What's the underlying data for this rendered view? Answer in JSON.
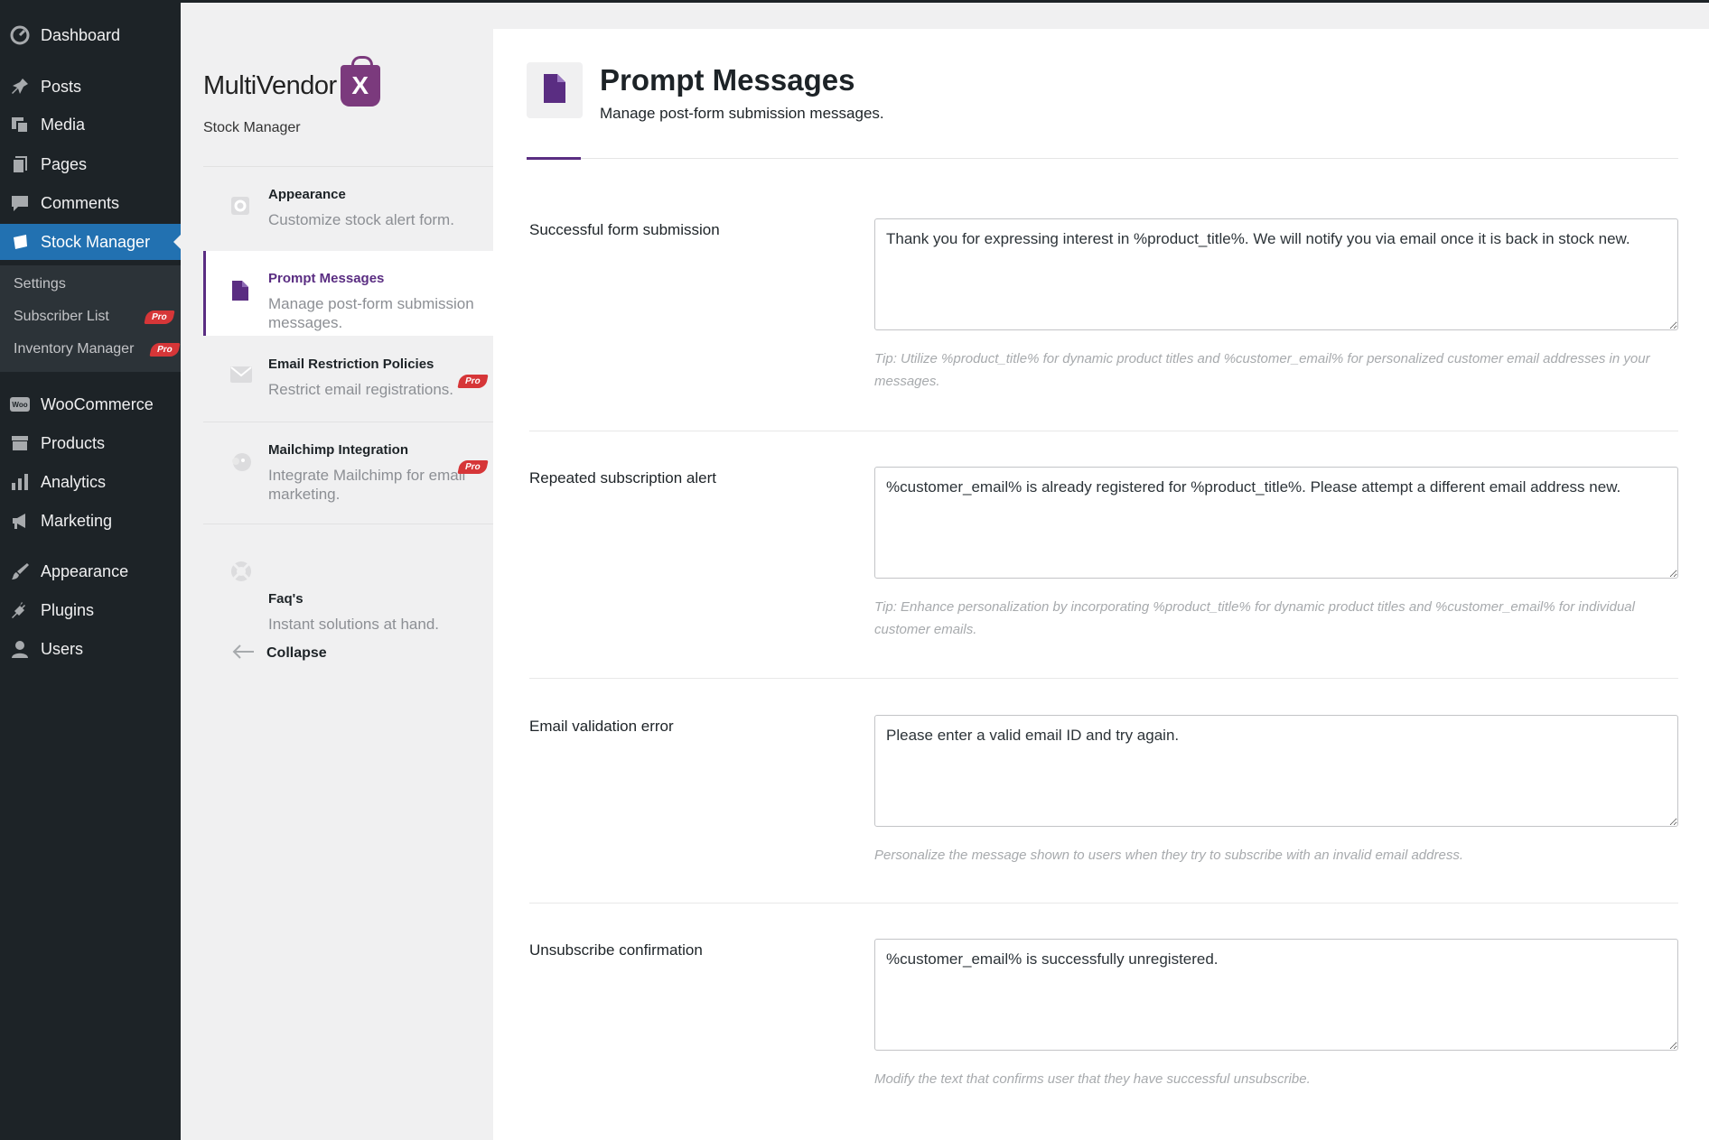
{
  "wp_menu": {
    "items": [
      {
        "label": "Dashboard",
        "icon": "dashboard-icon"
      },
      {
        "label": "Posts",
        "icon": "pin-icon"
      },
      {
        "label": "Media",
        "icon": "media-icon"
      },
      {
        "label": "Pages",
        "icon": "pages-icon"
      },
      {
        "label": "Comments",
        "icon": "comment-icon"
      },
      {
        "label": "Stock Manager",
        "icon": "stock-manager-icon"
      },
      {
        "label": "WooCommerce",
        "icon": "woocommerce-icon"
      },
      {
        "label": "Products",
        "icon": "archive-icon"
      },
      {
        "label": "Analytics",
        "icon": "bar-chart-icon"
      },
      {
        "label": "Marketing",
        "icon": "megaphone-icon"
      },
      {
        "label": "Appearance",
        "icon": "brush-icon"
      },
      {
        "label": "Plugins",
        "icon": "plugin-icon"
      },
      {
        "label": "Users",
        "icon": "user-icon"
      }
    ],
    "sub": [
      {
        "label": "Settings"
      },
      {
        "label": "Subscriber List",
        "badge": "Pro"
      },
      {
        "label": "Inventory Manager",
        "badge": "Pro"
      }
    ],
    "woo_icon_text": "Woo"
  },
  "plugin": {
    "logo_text": "MultiVendor",
    "logo_mark": "X",
    "subtitle": "Stock Manager",
    "nav": [
      {
        "title": "Appearance",
        "desc": "Customize stock alert form.",
        "icon": "gear-icon"
      },
      {
        "title": "Prompt Messages",
        "desc": "Manage post-form submission messages.",
        "icon": "document-icon"
      },
      {
        "title": "Email Restriction Policies",
        "desc": "Restrict email registrations.",
        "icon": "envelope-icon",
        "badge": "Pro"
      },
      {
        "title": "Mailchimp Integration",
        "desc": "Integrate Mailchimp for email marketing.",
        "icon": "mailchimp-icon",
        "badge": "Pro"
      },
      {
        "title": "Faq's",
        "desc": "Instant solutions at hand.",
        "icon": "lifebuoy-icon"
      }
    ],
    "collapse_label": "Collapse"
  },
  "page": {
    "title": "Prompt Messages",
    "description": "Manage post-form submission messages."
  },
  "fields": [
    {
      "label": "Successful form submission",
      "value": "Thank you for expressing interest in %product_title%. We will notify you via email once it is back in stock new.",
      "tip": "Tip: Utilize %product_title% for dynamic product titles and %customer_email% for personalized customer email addresses in your messages."
    },
    {
      "label": "Repeated subscription alert",
      "value": "%customer_email% is already registered for %product_title%. Please attempt a different email address new.",
      "tip": "Tip: Enhance personalization by incorporating %product_title% for dynamic product titles and %customer_email% for individual customer emails."
    },
    {
      "label": "Email validation error",
      "value": "Please enter a valid email ID and try again.",
      "tip": "Personalize the message shown to users when they try to subscribe with an invalid email address."
    },
    {
      "label": "Unsubscribe confirmation",
      "value": "%customer_email% is successfully unregistered.",
      "tip": "Modify the text that confirms user that they have successful unsubscribe."
    }
  ],
  "colors": {
    "wp_sidebar": "#1d2327",
    "wp_active": "#2271b1",
    "accent": "#5a2d82",
    "pro_badge": "#d63638"
  }
}
